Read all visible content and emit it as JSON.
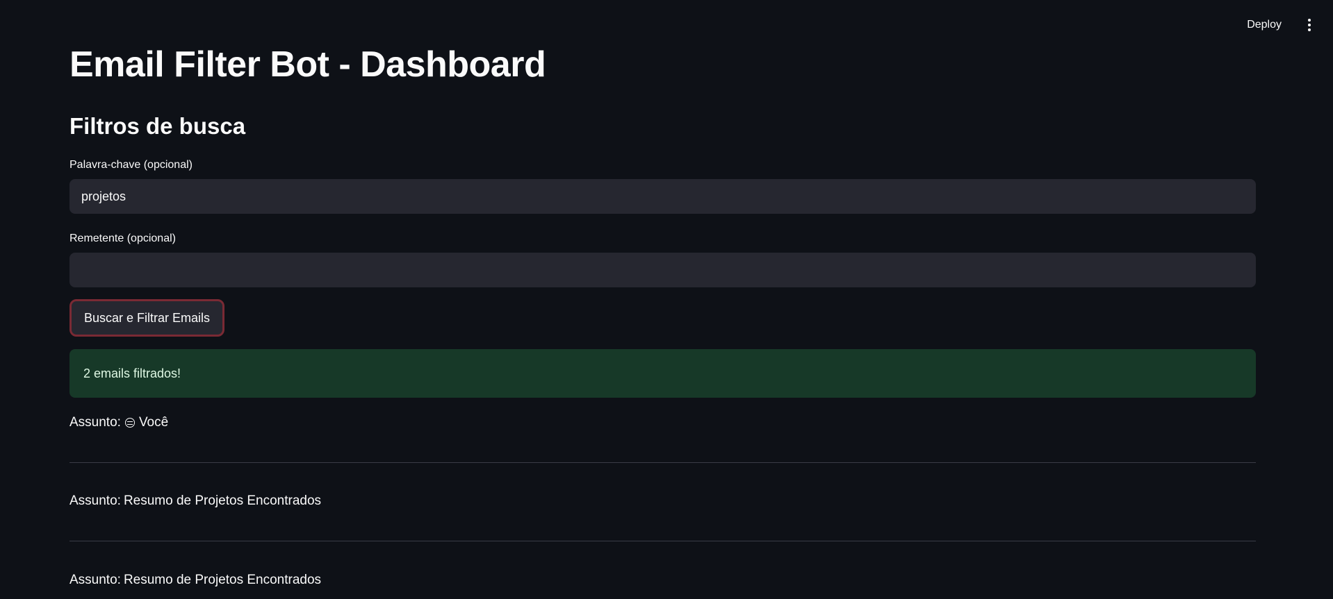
{
  "header": {
    "deploy_label": "Deploy",
    "menu_icon": "more-vertical-icon"
  },
  "main": {
    "title": "Email Filter Bot - Dashboard",
    "section_title": "Filtros de busca",
    "keyword": {
      "label": "Palavra-chave (opcional)",
      "value": "projetos",
      "placeholder": ""
    },
    "sender": {
      "label": "Remetente (opcional)",
      "value": "",
      "placeholder": ""
    },
    "search_button_label": "Buscar e Filtrar Emails",
    "success_message": "2 emails filtrados!",
    "emails": [
      {
        "prefix": "Assunto:",
        "icon": "emoji-face-icon",
        "subject": "Você"
      },
      {
        "prefix": "Assunto:",
        "subject": "Resumo de Projetos Encontrados"
      },
      {
        "prefix": "Assunto:",
        "subject": "Resumo de Projetos Encontrados"
      }
    ]
  },
  "colors": {
    "background": "#0e1117",
    "input_background": "#262730",
    "success_background": "#173928",
    "button_border": "#7a2a34"
  }
}
